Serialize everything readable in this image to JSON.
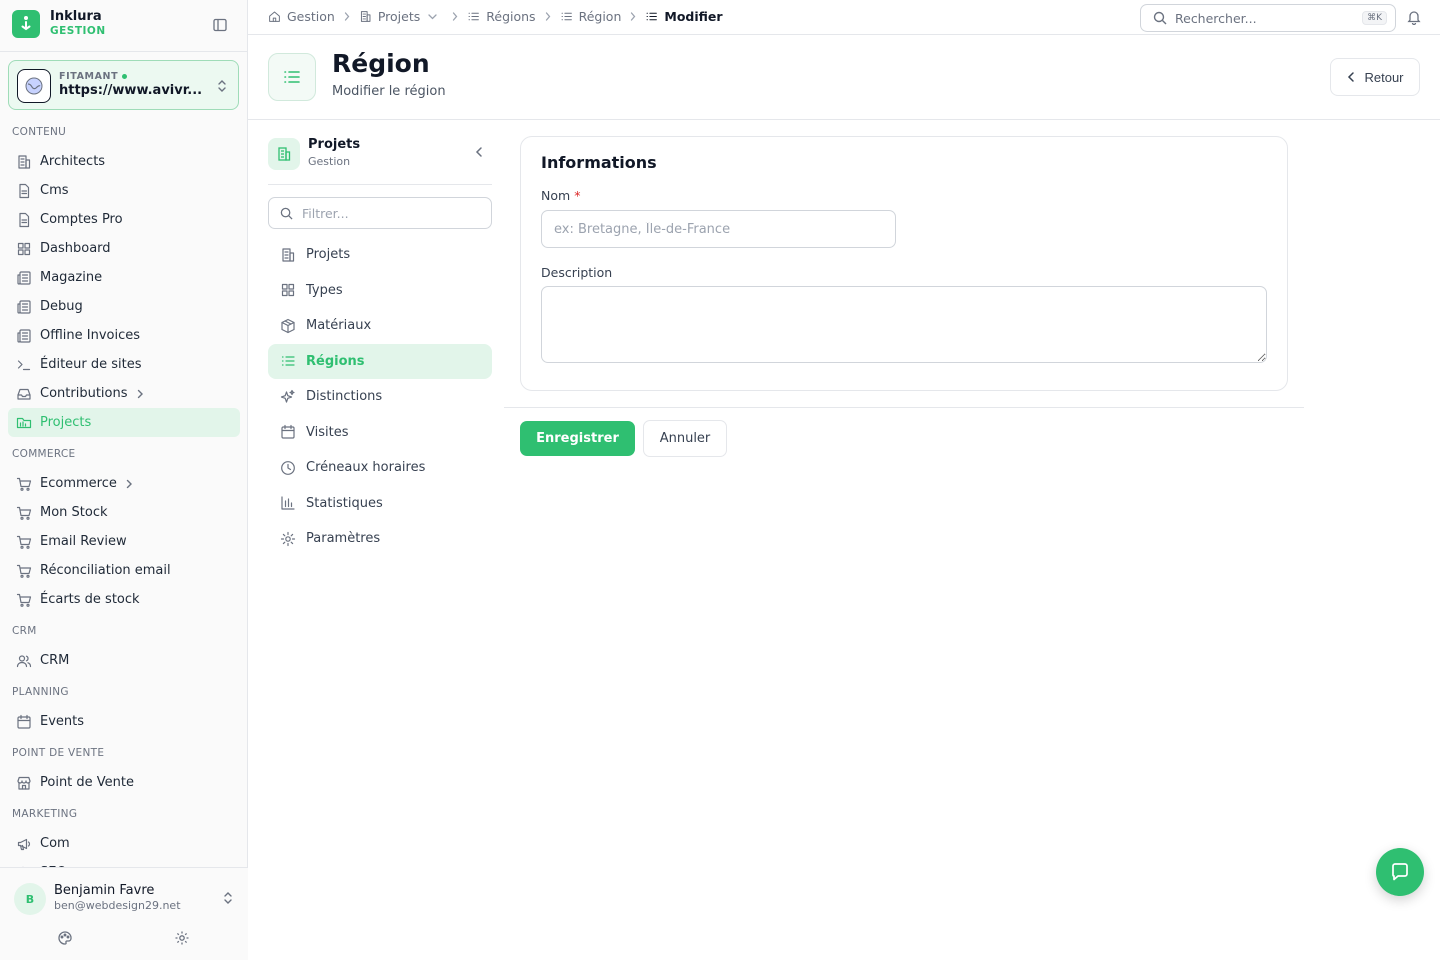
{
  "brand": {
    "name": "Inklura",
    "subtitle": "GESTION"
  },
  "tenant": {
    "label": "FITAMANT",
    "url": "https://www.avivr..."
  },
  "sidebar": {
    "sections": [
      {
        "title": "CONTENU",
        "items": [
          {
            "label": "Architects",
            "icon": "building-icon"
          },
          {
            "label": "Cms",
            "icon": "file-icon"
          },
          {
            "label": "Comptes Pro",
            "icon": "file-icon"
          },
          {
            "label": "Dashboard",
            "icon": "grid-icon"
          },
          {
            "label": "Magazine",
            "icon": "newspaper-icon"
          },
          {
            "label": "Debug",
            "icon": "newspaper-icon"
          },
          {
            "label": "Offline Invoices",
            "icon": "newspaper-icon"
          },
          {
            "label": "Éditeur de sites",
            "icon": "terminal-icon"
          },
          {
            "label": "Contributions",
            "icon": "inbox-icon",
            "has_children": true
          },
          {
            "label": "Projects",
            "icon": "folder-icon",
            "active": true
          }
        ]
      },
      {
        "title": "COMMERCE",
        "items": [
          {
            "label": "Ecommerce",
            "icon": "cart-icon",
            "has_children": true
          },
          {
            "label": "Mon Stock",
            "icon": "cart-icon"
          },
          {
            "label": "Email Review",
            "icon": "cart-icon"
          },
          {
            "label": "Réconciliation email",
            "icon": "cart-icon"
          },
          {
            "label": "Écarts de stock",
            "icon": "cart-icon"
          }
        ]
      },
      {
        "title": "CRM",
        "items": [
          {
            "label": "CRM",
            "icon": "users-icon"
          }
        ]
      },
      {
        "title": "PLANNING",
        "items": [
          {
            "label": "Events",
            "icon": "calendar-icon"
          }
        ]
      },
      {
        "title": "POINT DE VENTE",
        "items": [
          {
            "label": "Point de Vente",
            "icon": "store-icon"
          }
        ]
      },
      {
        "title": "MARKETING",
        "items": [
          {
            "label": "Com",
            "icon": "megaphone-icon"
          },
          {
            "label": "SEO",
            "icon": "search-icon"
          }
        ]
      }
    ]
  },
  "user": {
    "initial": "B",
    "name": "Benjamin Favre",
    "email": "ben@webdesign29.net"
  },
  "breadcrumb": [
    {
      "label": "Gestion",
      "icon": "home-icon"
    },
    {
      "label": "Projets",
      "icon": "building-icon",
      "dropdown": true
    },
    {
      "label": "Régions",
      "icon": "list-icon"
    },
    {
      "label": "Région",
      "icon": "list-icon"
    },
    {
      "label": "Modifier",
      "icon": "list-icon",
      "current": true
    }
  ],
  "search": {
    "placeholder": "Rechercher...",
    "shortcut": "⌘K"
  },
  "page": {
    "title": "Région",
    "subtitle": "Modifier le région",
    "back_label": "Retour"
  },
  "subnav": {
    "title": "Projets",
    "caption": "Gestion",
    "filter_placeholder": "Filtrer...",
    "items": [
      {
        "label": "Projets",
        "icon": "building-icon"
      },
      {
        "label": "Types",
        "icon": "grid-icon"
      },
      {
        "label": "Matériaux",
        "icon": "box-icon"
      },
      {
        "label": "Régions",
        "icon": "list-icon",
        "active": true
      },
      {
        "label": "Distinctions",
        "icon": "sparkles-icon"
      },
      {
        "label": "Visites",
        "icon": "calendar-icon"
      },
      {
        "label": "Créneaux horaires",
        "icon": "clock-icon"
      },
      {
        "label": "Statistiques",
        "icon": "bar-chart-icon"
      },
      {
        "label": "Paramètres",
        "icon": "gear-icon"
      }
    ]
  },
  "form": {
    "section_title": "Informations",
    "name_label": "Nom",
    "name_required": "*",
    "name_value": "",
    "name_placeholder": "ex: Bretagne, Île-de-France",
    "description_label": "Description",
    "description_value": "",
    "save_label": "Enregistrer",
    "cancel_label": "Annuler"
  },
  "colors": {
    "accent": "#2fbf71",
    "accent_soft": "#e2f5ea",
    "border": "#e5e7eb"
  }
}
